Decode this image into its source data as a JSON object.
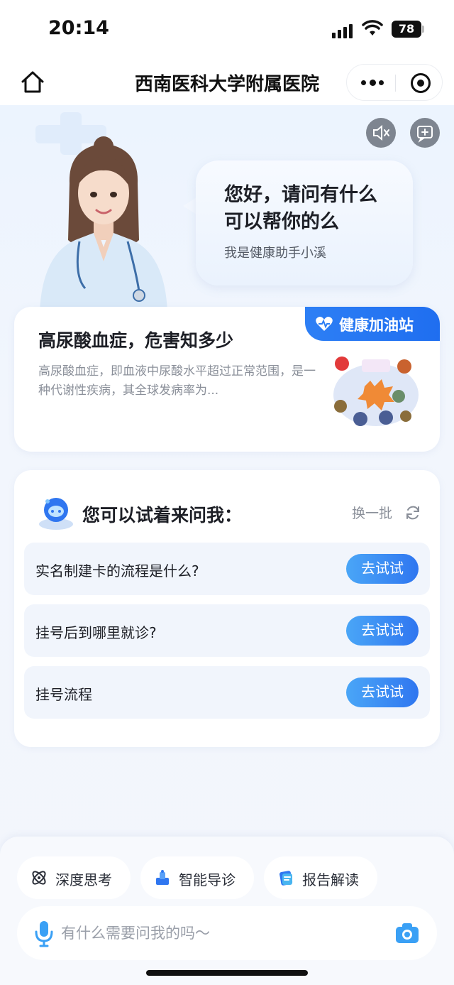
{
  "status_bar": {
    "time": "20:14",
    "battery": "78"
  },
  "nav": {
    "title": "西南医科大学附属医院"
  },
  "hero": {
    "greeting": "您好，请问有什么可以帮你的么",
    "subtitle": "我是健康助手小溪"
  },
  "article": {
    "tag": "健康加油站",
    "title": "高尿酸血症，危害知多少",
    "summary": "高尿酸血症，即血液中尿酸水平超过正常范围，是一种代谢性疾病，其全球发病率为..."
  },
  "ask": {
    "title": "您可以试着来问我：",
    "refresh_label": "换一批",
    "questions": [
      {
        "text": "实名制建卡的流程是什么?",
        "button": "去试试"
      },
      {
        "text": "挂号后到哪里就诊?",
        "button": "去试试"
      },
      {
        "text": "挂号流程",
        "button": "去试试"
      }
    ]
  },
  "bottom": {
    "chips": [
      {
        "label": "深度思考",
        "icon": "atom-icon"
      },
      {
        "label": "智能导诊",
        "icon": "guide-icon"
      },
      {
        "label": "报告解读",
        "icon": "report-icon"
      }
    ],
    "input_placeholder": "有什么需要问我的吗～"
  },
  "colors": {
    "accent": "#2f76f0",
    "button_gradient_start": "#4aa6f7",
    "tag_blue": "#2d7ff5"
  }
}
